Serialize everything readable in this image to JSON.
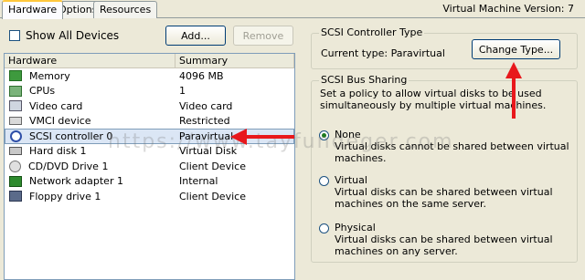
{
  "tabs": [
    {
      "label": "Hardware",
      "active": true
    },
    {
      "label": "Options",
      "active": false
    },
    {
      "label": "Resources",
      "active": false
    }
  ],
  "vm_version": "Virtual Machine Version: 7",
  "left": {
    "show_all_label": "Show All Devices",
    "show_all_checked": false,
    "add_label": "Add...",
    "remove_label": "Remove",
    "columns": [
      "Hardware",
      "Summary"
    ],
    "rows": [
      {
        "name": "Memory",
        "summary": "4096 MB",
        "icon": "memory-icon"
      },
      {
        "name": "CPUs",
        "summary": "1",
        "icon": "cpu-icon"
      },
      {
        "name": "Video card",
        "summary": "Video card",
        "icon": "video-card-icon"
      },
      {
        "name": "VMCI device",
        "summary": "Restricted",
        "icon": "vmci-device-icon"
      },
      {
        "name": "SCSI controller 0",
        "summary": "Paravirtual",
        "icon": "scsi-controller-icon",
        "selected": true
      },
      {
        "name": "Hard disk 1",
        "summary": "Virtual Disk",
        "icon": "hard-disk-icon"
      },
      {
        "name": "CD/DVD Drive 1",
        "summary": "Client Device",
        "icon": "cd-dvd-icon"
      },
      {
        "name": "Network adapter 1",
        "summary": "Internal",
        "icon": "network-adapter-icon"
      },
      {
        "name": "Floppy drive 1",
        "summary": "Client Device",
        "icon": "floppy-drive-icon"
      }
    ]
  },
  "scsi_type": {
    "title": "SCSI Controller Type",
    "current_label": "Current type:",
    "current_value": "Paravirtual",
    "change_label": "Change Type..."
  },
  "bus_sharing": {
    "title": "SCSI Bus Sharing",
    "description": "Set a policy to allow virtual disks to be used simultaneously by multiple virtual machines.",
    "options": [
      {
        "label": "None",
        "desc": "Virtual disks cannot be shared between virtual machines.",
        "checked": true
      },
      {
        "label": "Virtual",
        "desc": "Virtual disks can be shared between virtual machines on the same server.",
        "checked": false
      },
      {
        "label": "Physical",
        "desc": "Virtual disks can be shared between virtual machines on any server.",
        "checked": false
      }
    ]
  },
  "watermark": "https://www.tayfundeger.com",
  "colors": {
    "arrow": "#e8181c",
    "tab_highlight": "#ffc83c",
    "selected_row": "#dbe6f5"
  }
}
